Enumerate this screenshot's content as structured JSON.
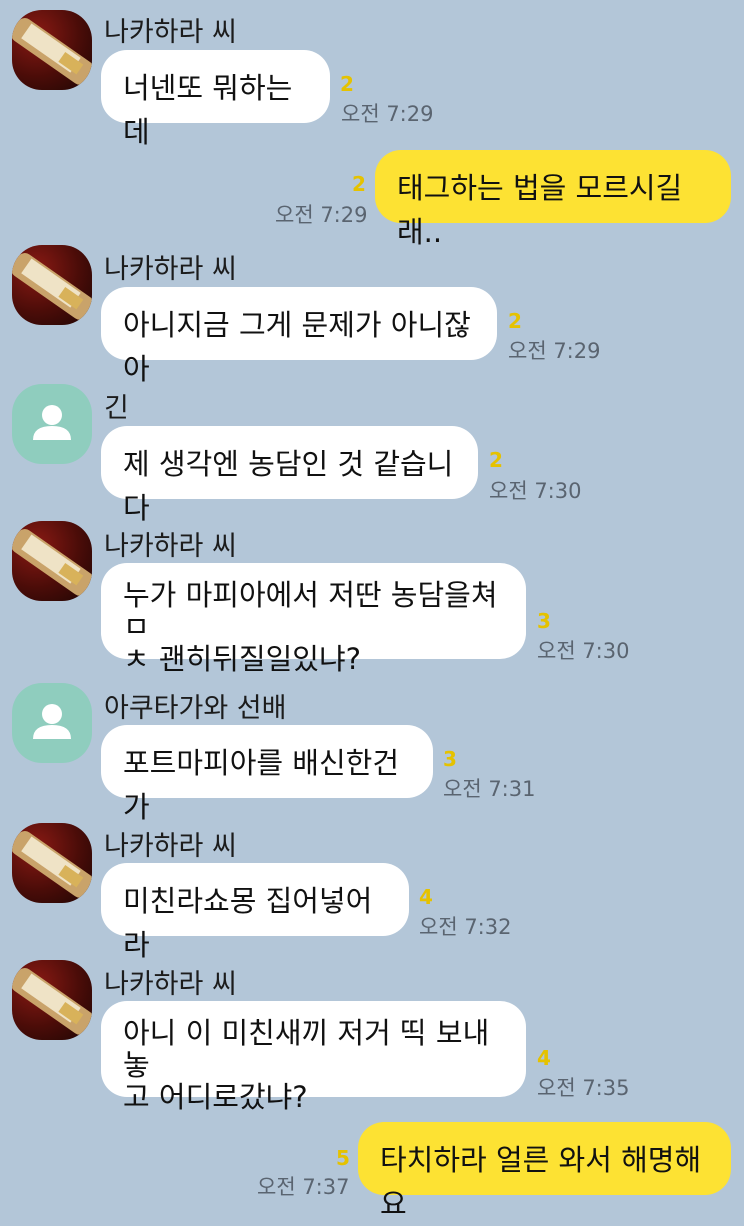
{
  "messages": [
    {
      "sender": "나카하라 씨",
      "avatar_icon": "bottle-icon",
      "text": "너넨또 뭐하는데",
      "read": "2",
      "time": "오전 7:29"
    },
    {
      "mine": true,
      "text": "태그하는 법을 모르시길래..",
      "read": "2",
      "time": "오전 7:29"
    },
    {
      "sender": "나카하라 씨",
      "avatar_icon": "bottle-icon",
      "text": "아니지금 그게 문제가 아니잖아",
      "read": "2",
      "time": "오전 7:29"
    },
    {
      "sender": "긴",
      "avatar_icon": "default-profile-icon",
      "text": "제 생각엔 농담인 것 같습니다",
      "read": "2",
      "time": "오전 7:30"
    },
    {
      "sender": "나카하라 씨",
      "avatar_icon": "bottle-icon",
      "text": "누가 마피아에서 저딴 농담을쳐ㅁ\nㅊ 괜히뒤질일있냐?",
      "read": "3",
      "time": "오전 7:30"
    },
    {
      "sender": "아쿠타가와 선배",
      "avatar_icon": "default-profile-icon",
      "text": "포트마피아를 배신한건가",
      "read": "3",
      "time": "오전 7:31"
    },
    {
      "sender": "나카하라 씨",
      "avatar_icon": "bottle-icon",
      "text": "미친라쇼몽 집어넣어라",
      "read": "4",
      "time": "오전 7:32"
    },
    {
      "sender": "나카하라 씨",
      "avatar_icon": "bottle-icon",
      "text": "아니 이 미친새끼 저거 띡 보내놓\n고 어디로갔냐?",
      "read": "4",
      "time": "오전 7:35"
    },
    {
      "mine": true,
      "text": "타치하라 얼른 와서 해명해요",
      "read": "5",
      "time": "오전 7:37"
    }
  ]
}
